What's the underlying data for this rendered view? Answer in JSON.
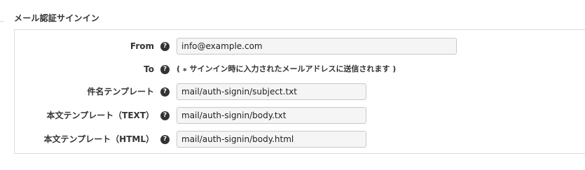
{
  "section": {
    "title": "メール認証サインイン"
  },
  "form": {
    "help_symbol": "?",
    "rows": [
      {
        "label": "From",
        "value": "info@example.com"
      },
      {
        "label": "To",
        "note": "( ⁎ サインイン時に入力されたメールアドレスに送信されます )"
      },
      {
        "label": "件名テンプレート",
        "value": "mail/auth-signin/subject.txt"
      },
      {
        "label": "本文テンプレート（TEXT）",
        "value": "mail/auth-signin/body.txt"
      },
      {
        "label": "本文テンプレート（HTML）",
        "value": "mail/auth-signin/body.html"
      }
    ]
  }
}
